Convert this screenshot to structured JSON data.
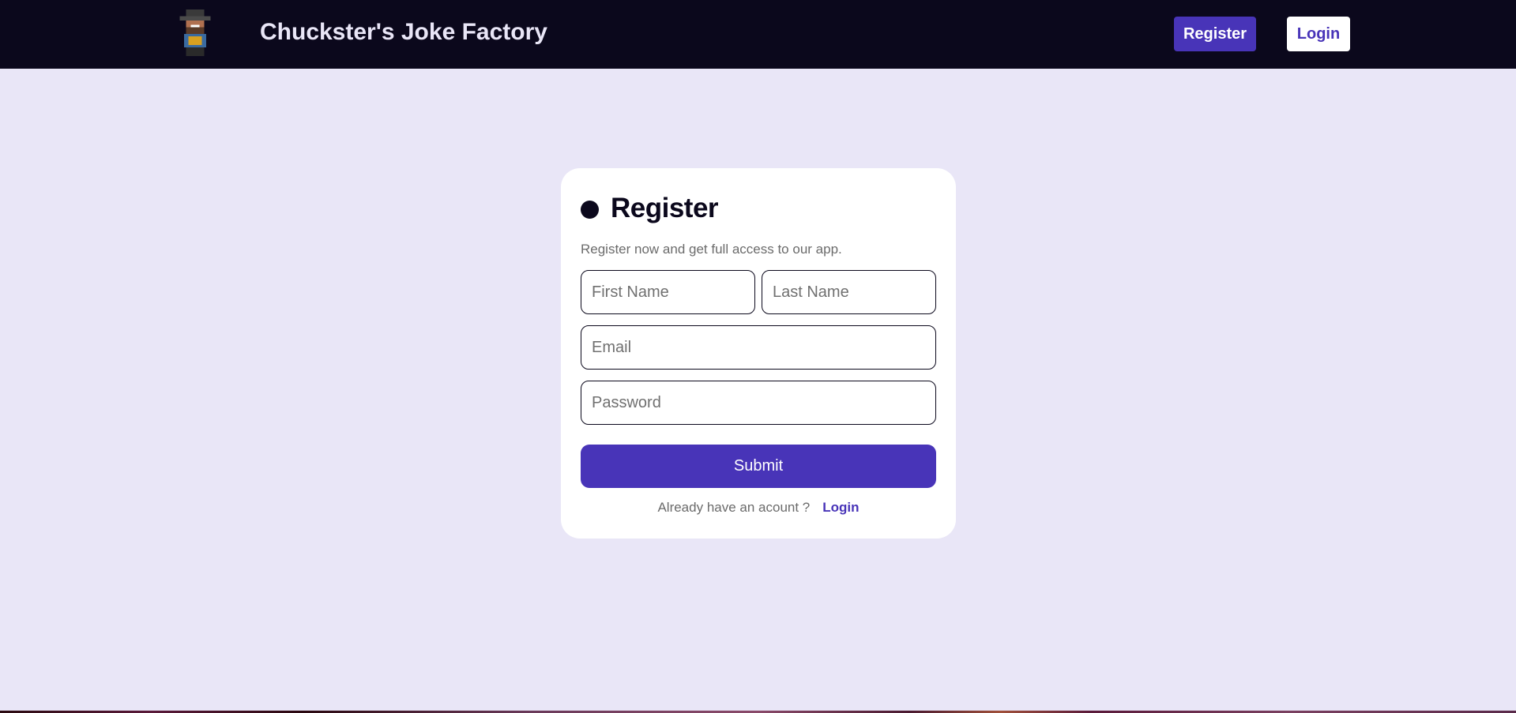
{
  "header": {
    "logo_icon": "chuck-pixel-avatar-icon",
    "title": "Chuckster's Joke Factory",
    "register_label": "Register",
    "login_label": "Login"
  },
  "form": {
    "title": "Register",
    "subtitle": "Register now and get full access to our app.",
    "first_name_placeholder": "First Name",
    "last_name_placeholder": "Last Name",
    "email_placeholder": "Email",
    "password_placeholder": "Password",
    "submit_label": "Submit",
    "footer_text": "Already have an acount ?",
    "footer_link": "Login"
  },
  "colors": {
    "header_bg": "#0b081c",
    "page_bg": "#e9e6f7",
    "accent": "#4834b8"
  }
}
